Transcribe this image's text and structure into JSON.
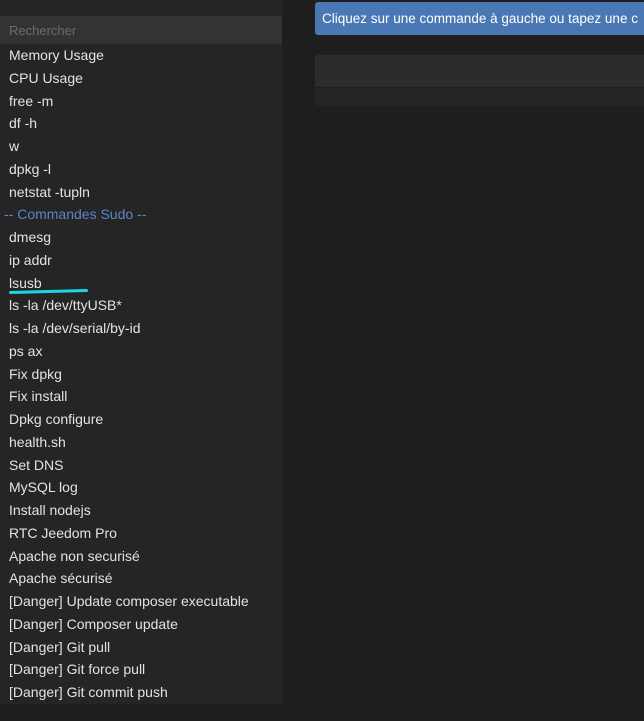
{
  "search": {
    "placeholder": "Rechercher"
  },
  "commands": [
    {
      "label": "Memory Usage"
    },
    {
      "label": "CPU Usage"
    },
    {
      "label": "free -m"
    },
    {
      "label": "df -h"
    },
    {
      "label": "w"
    },
    {
      "label": "dpkg -l"
    },
    {
      "label": "netstat -tupln"
    },
    {
      "label": "-- Commandes Sudo --",
      "header": true
    },
    {
      "label": "dmesg"
    },
    {
      "label": "ip addr"
    },
    {
      "label": "lsusb"
    },
    {
      "label": "ls -la /dev/ttyUSB*"
    },
    {
      "label": "ls -la /dev/serial/by-id"
    },
    {
      "label": "ps ax"
    },
    {
      "label": "Fix dpkg"
    },
    {
      "label": "Fix install"
    },
    {
      "label": "Dpkg configure"
    },
    {
      "label": "health.sh"
    },
    {
      "label": "Set DNS"
    },
    {
      "label": "MySQL log"
    },
    {
      "label": "Install nodejs"
    },
    {
      "label": "RTC Jeedom Pro"
    },
    {
      "label": "Apache non securisé"
    },
    {
      "label": "Apache sécurisé"
    },
    {
      "label": "[Danger] Update composer executable"
    },
    {
      "label": "[Danger] Composer update"
    },
    {
      "label": "[Danger] Git pull"
    },
    {
      "label": "[Danger] Git force pull"
    },
    {
      "label": "[Danger] Git commit push"
    }
  ],
  "main": {
    "banner_text": "Cliquez sur une commande à gauche ou tapez une c"
  },
  "colors": {
    "accent": "#4a78b5",
    "group_header": "#5a86c6",
    "annotation": "#19d6e6"
  }
}
